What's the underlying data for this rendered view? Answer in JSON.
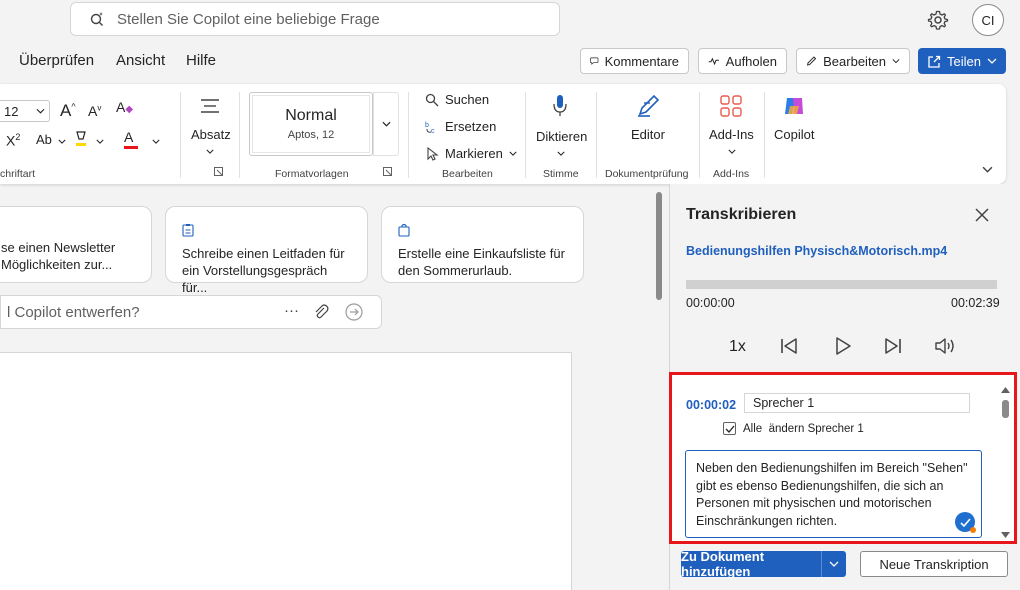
{
  "search": {
    "placeholder": "Stellen Sie Copilot eine beliebige Frage"
  },
  "user": {
    "initials": "CI"
  },
  "menu": {
    "items": [
      "Überprüfen",
      "Ansicht",
      "Hilfe"
    ]
  },
  "actions": {
    "comments": "Kommentare",
    "catchup": "Aufholen",
    "edit": "Bearbeiten",
    "share": "Teilen"
  },
  "ribbon": {
    "font_size": "12",
    "font_group": "chriftart",
    "paragraph": "Absatz",
    "style_name": "Normal",
    "style_sub": "Aptos, 12",
    "styles_group": "Formatvorlagen",
    "find": "Suchen",
    "replace": "Ersetzen",
    "select": "Markieren",
    "editing_group": "Bearbeiten",
    "dictate": "Diktieren",
    "voice_group": "Stimme",
    "editor": "Editor",
    "proofing_group": "Dokumentprüfung",
    "addins": "Add-Ins",
    "addins_group": "Add-Ins",
    "copilot": "Copilot"
  },
  "cards": [
    {
      "line1": "se einen Newsletter",
      "line2": "Möglichkeiten zur..."
    },
    {
      "line1": "Schreibe einen Leitfaden für",
      "line2": "ein Vorstellungsgespräch für..."
    },
    {
      "line1": "Erstelle eine Einkaufsliste für",
      "line2": "den Sommerurlaub."
    }
  ],
  "prompt": {
    "placeholder": "l Copilot entwerfen?"
  },
  "pane": {
    "title": "Transkribieren",
    "file": "Bedienungshilfen Physisch&Motorisch.mp4",
    "progress": 0.0,
    "time_current": "00:00:00",
    "time_total": "00:02:39",
    "speed": "1x",
    "segment": {
      "time": "00:00:02",
      "speaker": "Sprecher 1",
      "checkbox_label": "Alle  ändern Sprecher 1",
      "checked": true,
      "text": "Neben den Bedienungshilfen im Bereich \"Sehen\" gibt es ebenso Bedienungshilfen, die sich an Personen mit physischen und motorischen Einschränkungen richten."
    },
    "add_button": "Zu Dokument hinzufügen",
    "new_button": "Neue Transkription"
  },
  "colors": {
    "accent": "#1f5fbd",
    "highlight_border": "#e8161b"
  }
}
